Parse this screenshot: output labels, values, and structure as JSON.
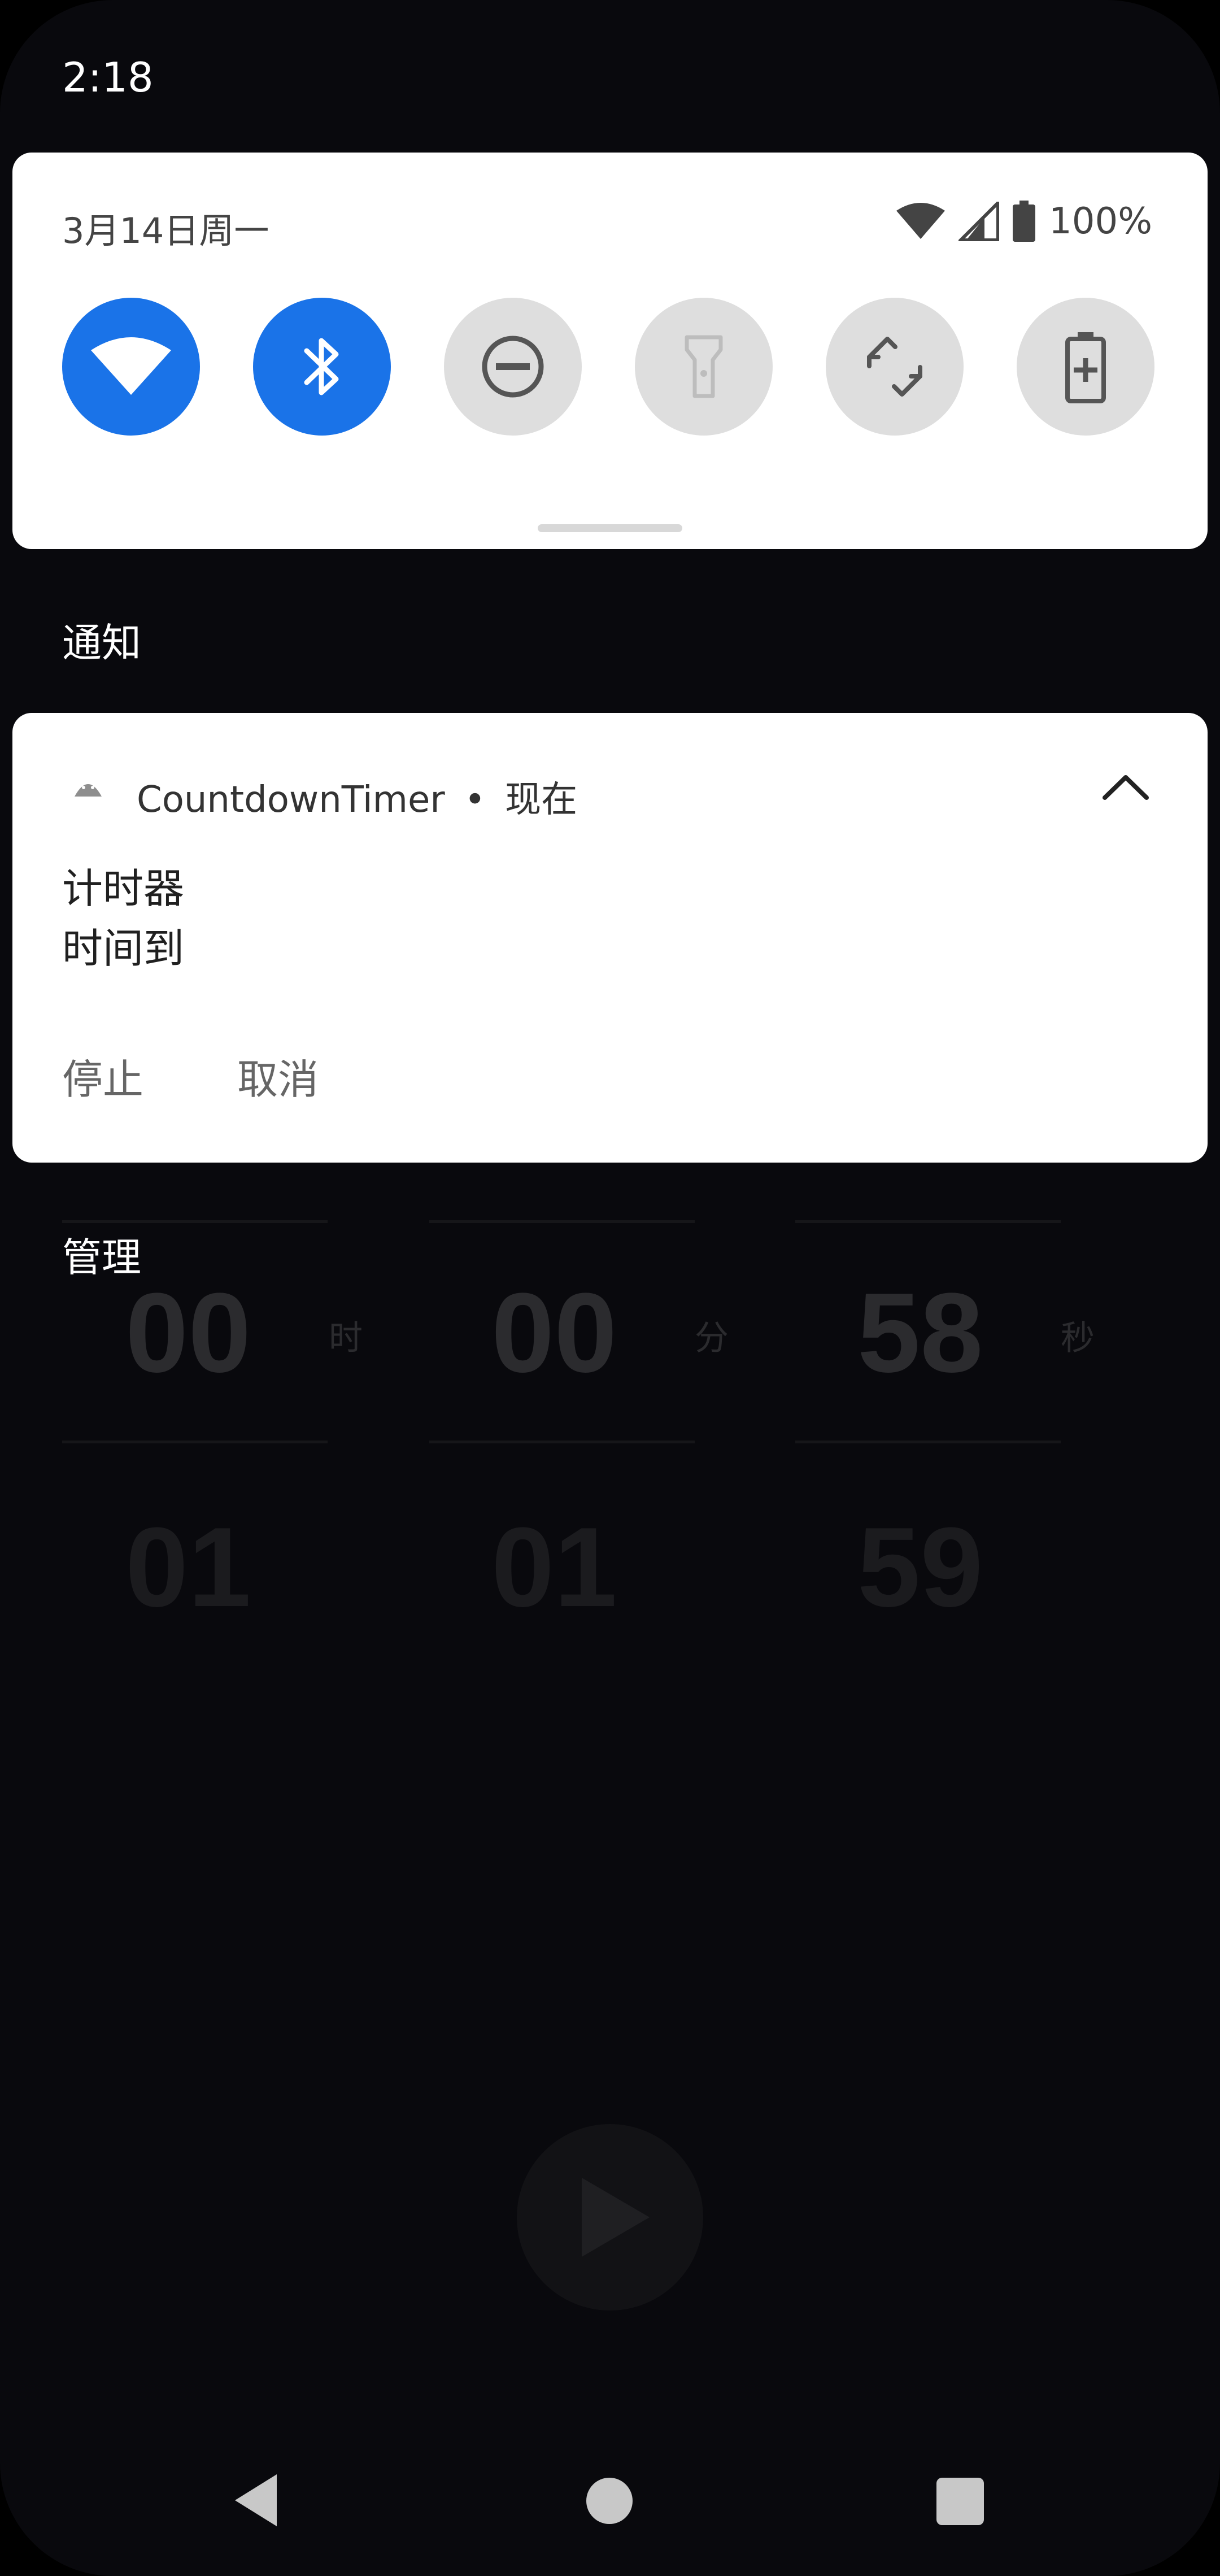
{
  "status_bar": {
    "time": "2:18"
  },
  "quick_settings": {
    "date": "3月14日周一",
    "battery_percent": "100%",
    "tiles": [
      {
        "name": "wifi",
        "active": true
      },
      {
        "name": "bluetooth",
        "active": true
      },
      {
        "name": "do-not-disturb",
        "active": false
      },
      {
        "name": "flashlight",
        "active": false
      },
      {
        "name": "auto-rotate",
        "active": false
      },
      {
        "name": "battery-saver",
        "active": false
      }
    ],
    "colors": {
      "active": "#1a73e8",
      "inactive": "#dedede"
    }
  },
  "notifications_header": "通知",
  "notification": {
    "app_name": "CountdownTimer",
    "separator": "•",
    "time": "现在",
    "title": "计时器",
    "text": "时间到",
    "actions": [
      "停止",
      "取消"
    ]
  },
  "manage_label": "管理",
  "timer_app": {
    "current": {
      "hours": "00",
      "minutes": "00",
      "seconds": "58"
    },
    "next": {
      "hours": "01",
      "minutes": "01",
      "seconds": "59"
    },
    "units": {
      "hours": "时",
      "minutes": "分",
      "seconds": "秒"
    }
  }
}
